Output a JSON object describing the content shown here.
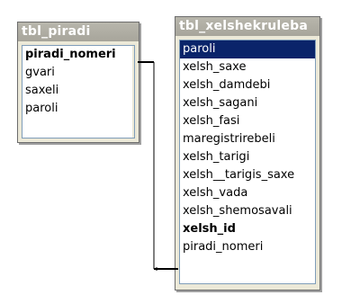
{
  "tables": [
    {
      "name": "tbl_piradi",
      "fields": [
        {
          "label": "piradi_nomeri",
          "key": true
        },
        {
          "label": "gvari",
          "key": false
        },
        {
          "label": "saxeli",
          "key": false
        },
        {
          "label": "paroli",
          "key": false
        }
      ]
    },
    {
      "name": "tbl_xelshekruleba",
      "fields": [
        {
          "label": "paroli",
          "key": false,
          "selected": true
        },
        {
          "label": "xelsh_saxe",
          "key": false
        },
        {
          "label": "xelsh_damdebi",
          "key": false
        },
        {
          "label": "xelsh_sagani",
          "key": false
        },
        {
          "label": "xelsh_fasi",
          "key": false
        },
        {
          "label": "maregistrirebeli",
          "key": false
        },
        {
          "label": "xelsh_tarigi",
          "key": false
        },
        {
          "label": "xelsh__tarigis_saxe",
          "key": false
        },
        {
          "label": "xelsh_vada",
          "key": false
        },
        {
          "label": "xelsh_shemosavali",
          "key": false
        },
        {
          "label": "xelsh_id",
          "key": true
        },
        {
          "label": "piradi_nomeri",
          "key": false
        }
      ]
    }
  ],
  "relationship": {
    "from_table": "tbl_piradi",
    "from_field": "piradi_nomeri",
    "to_table": "tbl_xelshekruleba",
    "to_field": "piradi_nomeri"
  }
}
